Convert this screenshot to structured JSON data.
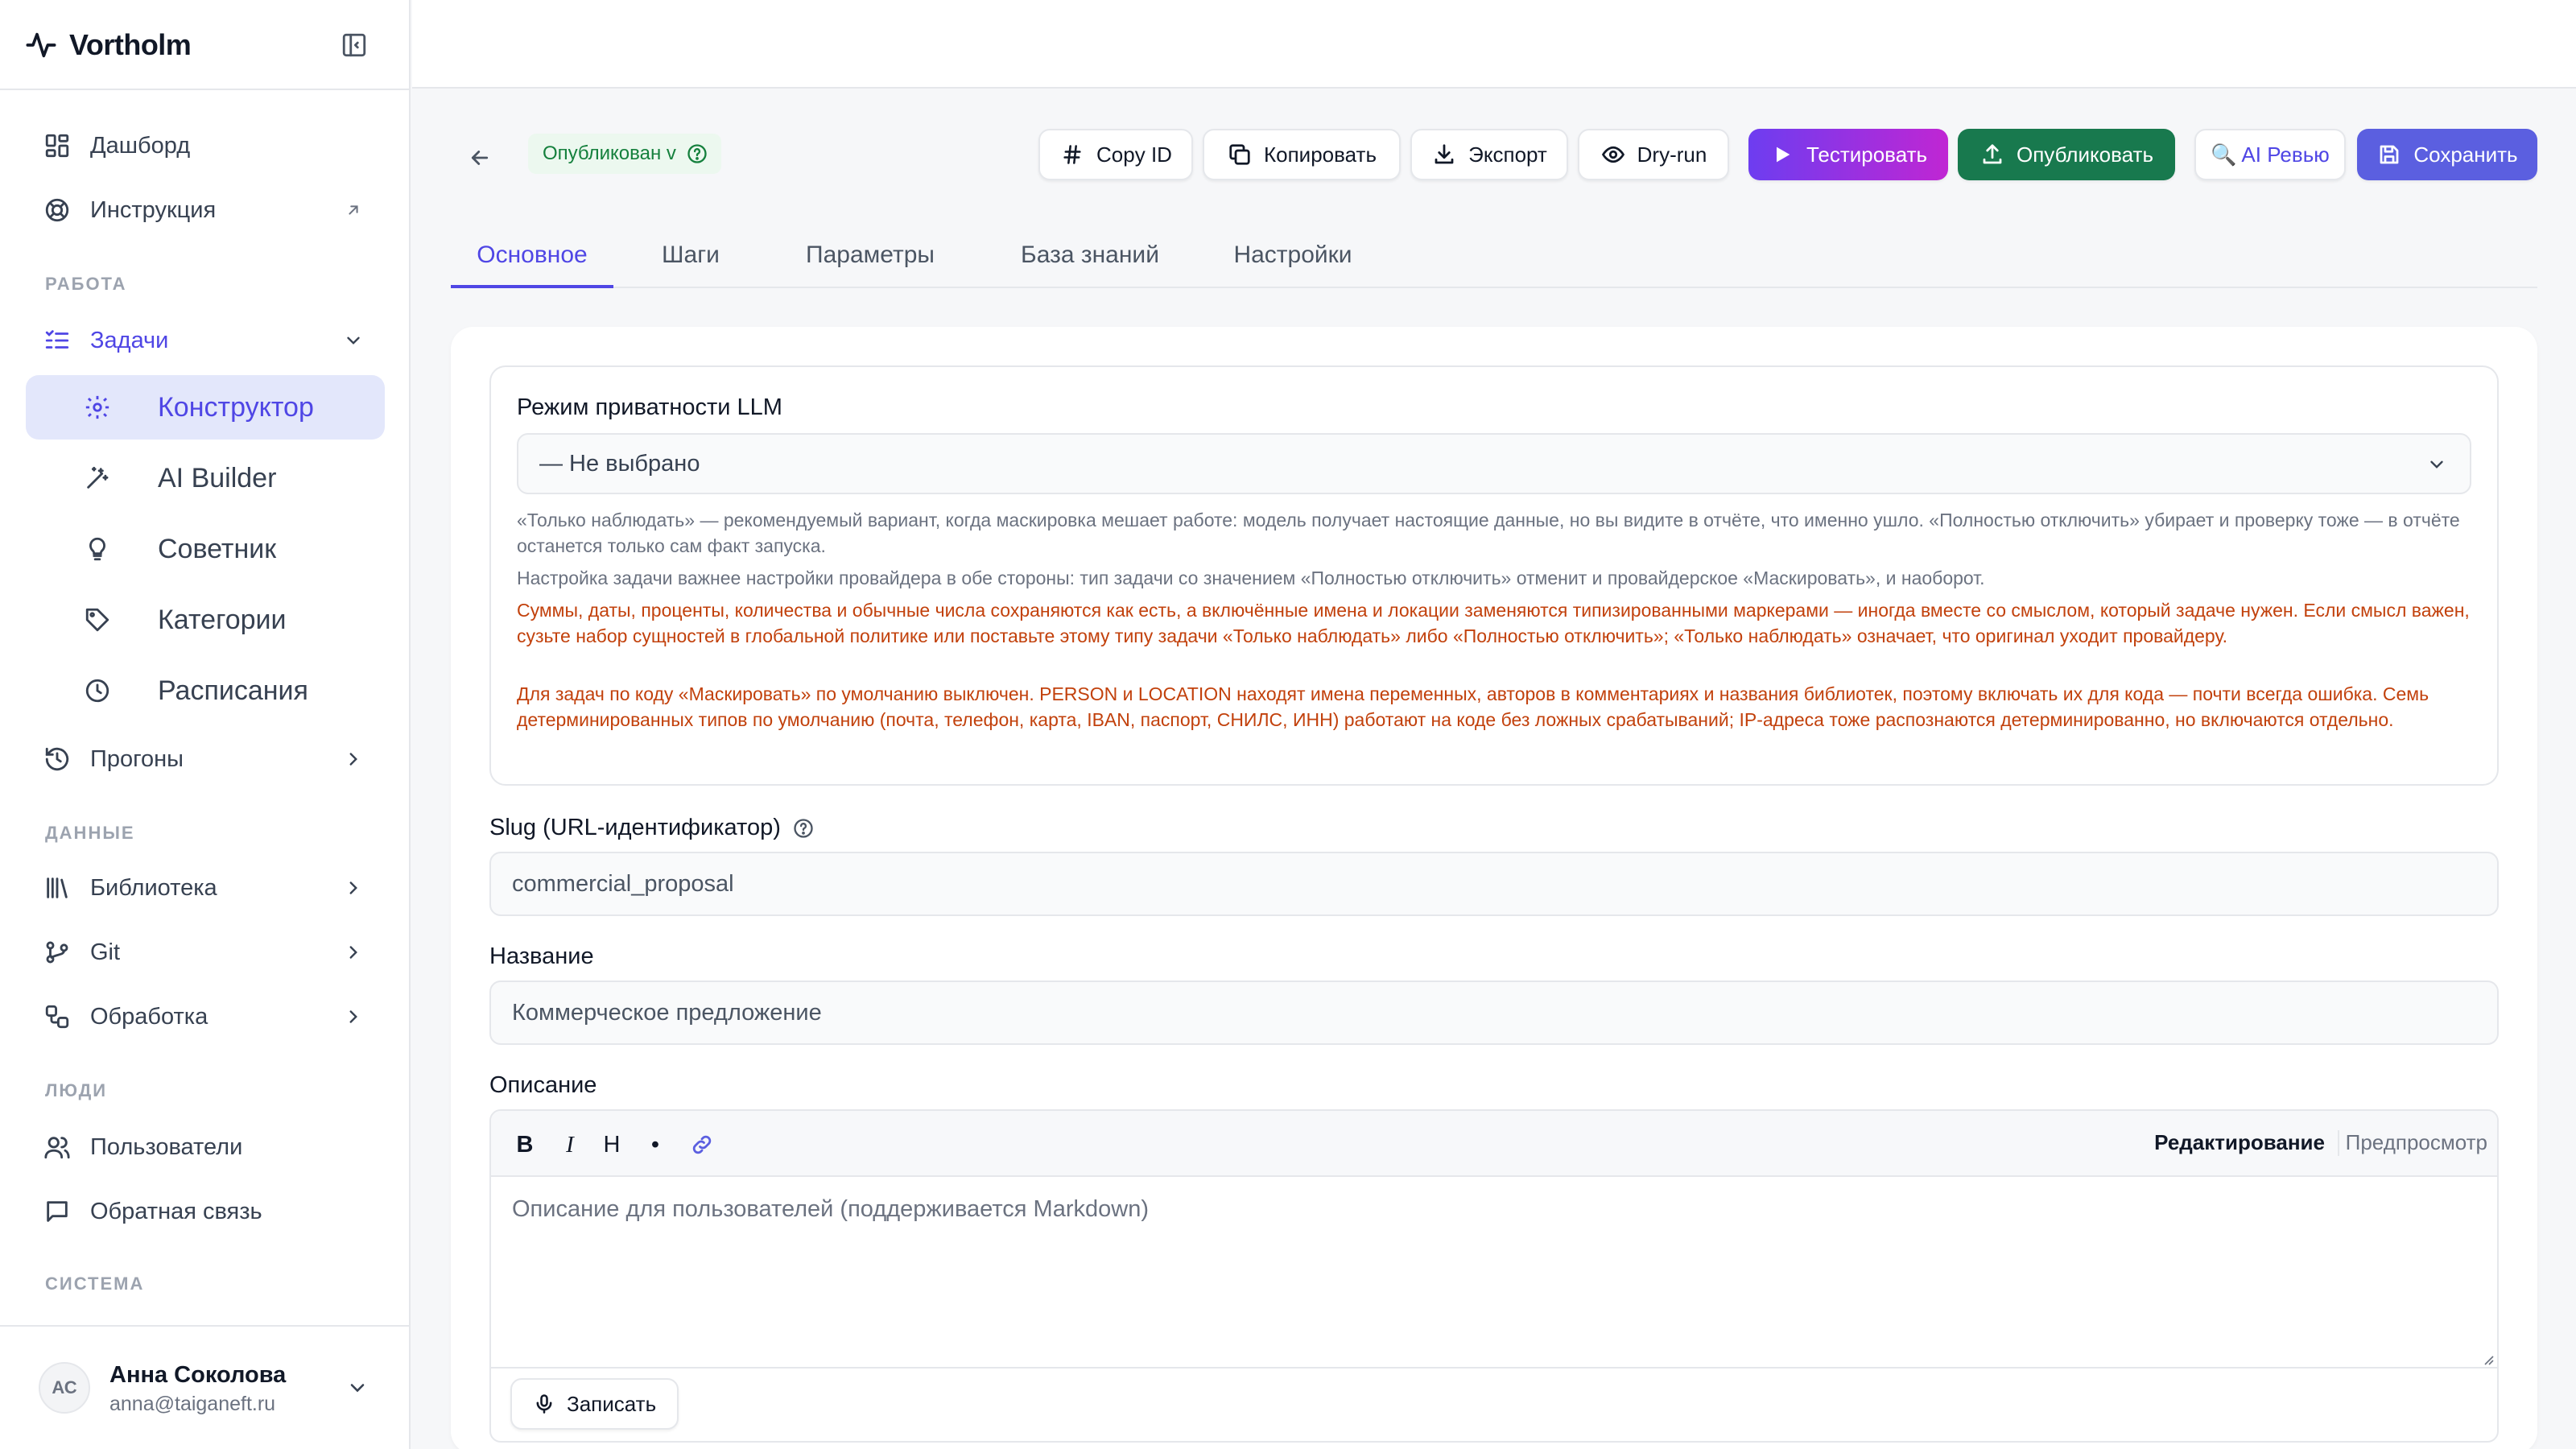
{
  "brand": {
    "name": "Vortholm"
  },
  "sidebar": {
    "top_items": [
      {
        "label": "Дашборд",
        "icon": "dashboard-icon"
      },
      {
        "label": "Инструкция",
        "icon": "lifebuoy-icon"
      }
    ],
    "sections": {
      "work": "РАБОТА",
      "data": "ДАННЫЕ",
      "people": "ЛЮДИ",
      "system": "СИСТЕМА"
    },
    "tasks": {
      "label": "Задачи",
      "children": [
        {
          "label": "Конструктор",
          "icon": "gear-icon"
        },
        {
          "label": "AI Builder",
          "icon": "magic-wand-icon"
        },
        {
          "label": "Советник",
          "icon": "lightbulb-icon"
        },
        {
          "label": "Категории",
          "icon": "tag-icon"
        },
        {
          "label": "Расписания",
          "icon": "clock-icon"
        }
      ]
    },
    "runs": {
      "label": "Прогоны"
    },
    "data_items": [
      {
        "label": "Библиотека"
      },
      {
        "label": "Git"
      },
      {
        "label": "Обработка"
      }
    ],
    "people_items": [
      {
        "label": "Пользователи"
      },
      {
        "label": "Обратная связь"
      }
    ],
    "user": {
      "initials": "АС",
      "name": "Анна Соколова",
      "email": "anna@taiganeft.ru"
    }
  },
  "header": {
    "status": "Опубликован v",
    "buttons": {
      "copy_id": "Copy ID",
      "copy": "Копировать",
      "export": "Экспорт",
      "dry_run": "Dry-run",
      "test": "Тестировать",
      "publish": "Опубликовать",
      "ai_review": "🔍 AI Ревью",
      "save": "Сохранить"
    }
  },
  "tabs": [
    "Основное",
    "Шаги",
    "Параметры",
    "База знаний",
    "Настройки"
  ],
  "form": {
    "privacy": {
      "label": "Режим приватности LLM",
      "value": "— Не выбрано",
      "note1": "«Только наблюдать» — рекомендуемый вариант, когда маскировка мешает работе: модель получает настоящие данные, но вы видите в отчёте, что именно ушло. «Полностью отключить» убирает и проверку тоже — в отчёте останется только сам факт запуска.",
      "note2": "Настройка задачи важнее настройки провайдера в обе стороны: тип задачи со значением «Полностью отключить» отменит и провайдерское «Маскировать», и наоборот.",
      "warn1": "Суммы, даты, проценты, количества и обычные числа сохраняются как есть, а включённые имена и локации заменяются типизированными маркерами — иногда вместе со смыслом, который задаче нужен. Если смысл важен, сузьте набор сущностей в глобальной политике или поставьте этому типу задачи «Только наблюдать» либо «Полностью отключить»; «Только наблюдать» означает, что оригинал уходит провайдеру.",
      "warn2": "Для задач по коду «Маскировать» по умолчанию выключен. PERSON и LOCATION находят имена переменных, авторов в комментариях и названия библиотек, поэтому включать их для кода — почти всегда ошибка. Семь детерминированных типов по умолчанию (почта, телефон, карта, IBAN, паспорт, СНИЛС, ИНН) работают на коде без ложных срабатываний; IP-адреса тоже распознаются детерминированно, но включаются отдельно."
    },
    "slug": {
      "label": "Slug (URL-идентификатор)",
      "value": "commercial_proposal"
    },
    "name": {
      "label": "Название",
      "value": "Коммерческое предложение"
    },
    "description": {
      "label": "Описание",
      "toolbar": {
        "bold": "B",
        "italic": "I",
        "heading": "H",
        "bullet": "•"
      },
      "mode_edit": "Редактирование",
      "mode_preview": "Предпросмотр",
      "placeholder": "Описание для пользователей (поддерживается Markdown)",
      "record": "Записать"
    }
  }
}
